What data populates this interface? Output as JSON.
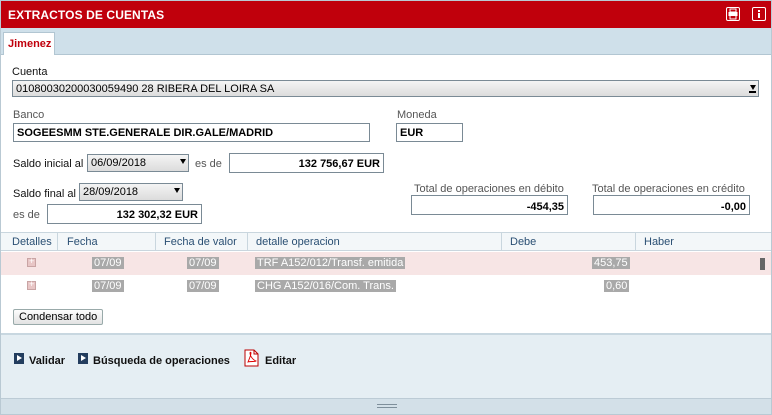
{
  "window": {
    "title": "EXTRACTOS DE CUENTAS",
    "icons": [
      "print-icon",
      "info-icon"
    ]
  },
  "tabs": [
    {
      "label": "Jimenez"
    }
  ],
  "form": {
    "cuenta_label": "Cuenta",
    "cuenta_value": "0108003020003005949​0 28 RIBERA DEL LOIRA SA",
    "banco_label": "Banco",
    "banco_value": "SOGEESMM STE.GENERALE DIR.GALE/MADRID",
    "moneda_label": "Moneda",
    "moneda_value": "EUR",
    "saldo_inicial_label": "Saldo inicial al",
    "saldo_inicial_date": "06/09/2018",
    "saldo_inicial_es_de": "es de",
    "saldo_inicial_amount": "132 756,67 EUR",
    "saldo_final_label": "Saldo final al",
    "saldo_final_date": "28/09/2018",
    "saldo_final_es_de": "es de",
    "saldo_final_amount": "132 302,32 EUR",
    "total_debito_label": "Total de operaciones en débito",
    "total_debito_value": "-454,35",
    "total_credito_label": "Total de operaciones en crédito",
    "total_credito_value": "-0,00"
  },
  "table": {
    "columns": [
      "Detalles",
      "Fecha",
      "Fecha de valor",
      "detalle operacion",
      "Debe",
      "Haber"
    ],
    "rows": [
      {
        "fecha": "07/09",
        "fecha_valor": "07/09",
        "detalle": "TRF A152/012/Transf. emitida",
        "debe": "453,75",
        "haber": ""
      },
      {
        "fecha": "07/09",
        "fecha_valor": "07/09",
        "detalle": "CHG A152/016/Com. Trans.",
        "debe": "0,60",
        "haber": ""
      }
    ]
  },
  "buttons": {
    "condensar": "Condensar todo",
    "validar": "Validar",
    "busqueda": "Búsqueda de operaciones",
    "editar": "Editar"
  },
  "colors": {
    "accent": "#c0000c",
    "header_text": "#2a4f73",
    "panel_bg": "#e5eef3"
  }
}
